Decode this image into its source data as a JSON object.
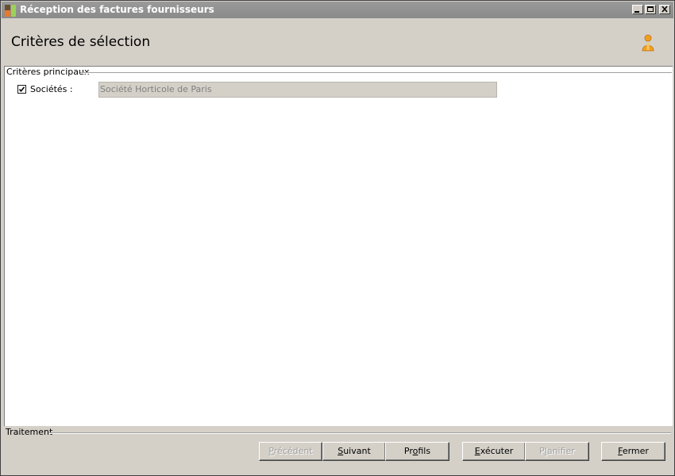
{
  "window": {
    "title": "Réception des factures fournisseurs",
    "controls": [
      "minimize-icon",
      "maximize-icon",
      "close-icon"
    ]
  },
  "header": {
    "title": "Critères de sélection",
    "icon": "user-icon",
    "icon_color": "#f0a020"
  },
  "main_criteria": {
    "group_label": "Critères principaux",
    "societes": {
      "checked": true,
      "label": "Sociétés :",
      "value": "Société Horticole de Paris"
    }
  },
  "processing": {
    "group_label": "Traitement",
    "buttons": [
      {
        "pre": "",
        "acc": "P",
        "post": "récédent",
        "enabled": false
      },
      {
        "pre": "",
        "acc": "S",
        "post": "uivant",
        "enabled": true
      },
      {
        "pre": "Pr",
        "acc": "o",
        "post": "fils",
        "enabled": true
      },
      {
        "pre": "",
        "acc": "E",
        "post": "xécuter",
        "enabled": true
      },
      {
        "pre": "P",
        "acc": "l",
        "post": "anifier",
        "enabled": false
      },
      {
        "pre": "",
        "acc": "F",
        "post": "ermer",
        "enabled": true
      }
    ]
  }
}
